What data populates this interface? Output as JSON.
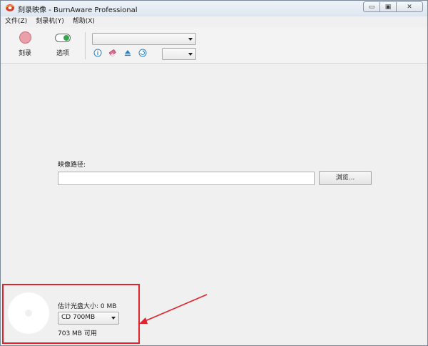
{
  "window": {
    "title": "刻录映像 - BurnAware Professional",
    "controls": {
      "minimize": "▭",
      "maximize": "▣",
      "close": "✕"
    }
  },
  "menubar": {
    "items": [
      {
        "label": "文件(Z)"
      },
      {
        "label": "刻录机(Y)"
      },
      {
        "label": "帮助(X)"
      }
    ]
  },
  "toolbar": {
    "burn_label": "刻录",
    "options_label": "选项",
    "drive_select_value": "",
    "speed_select_value": "",
    "icons": [
      "info-icon",
      "erase-icon",
      "eject-icon",
      "refresh-icon"
    ]
  },
  "main": {
    "image_path_label": "映像路径:",
    "image_path_value": "",
    "browse_button": "浏览..."
  },
  "footer": {
    "estimated_size_label": "估计光盘大小: 0 MB",
    "disc_type_value": "CD 700MB",
    "available_label": "703 MB 可用"
  },
  "colors": {
    "annotation_red": "#e0232c",
    "burn_red": "#e9a0a8",
    "toggle_green": "#33a84a",
    "icon_blue": "#2d7fc3"
  }
}
